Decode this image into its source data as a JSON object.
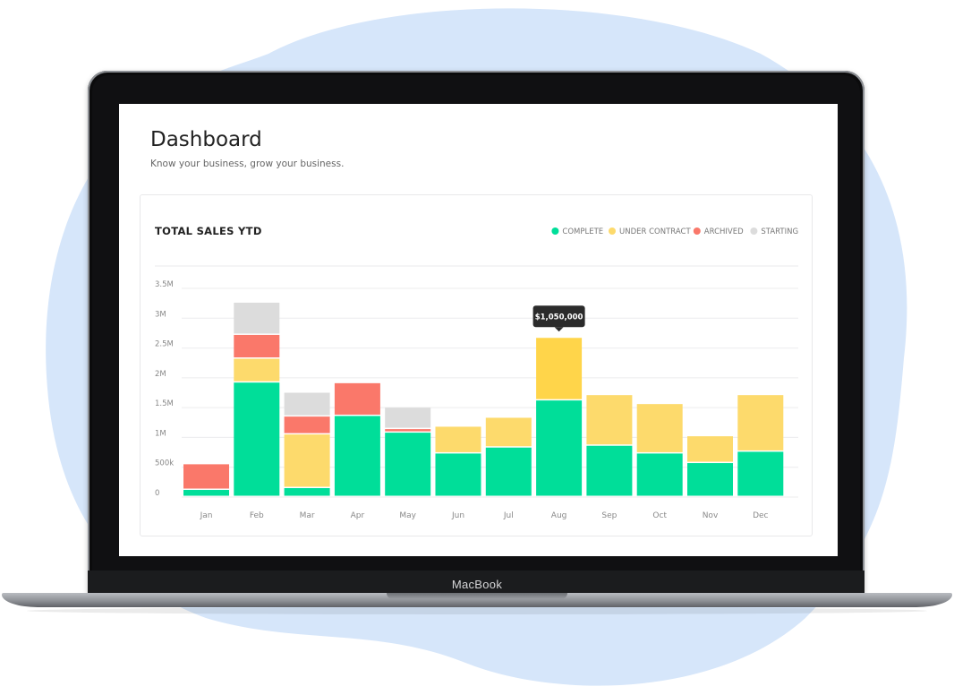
{
  "page": {
    "title": "Dashboard",
    "subtitle": "Know your business, grow your business."
  },
  "device": {
    "brand": "MacBook"
  },
  "colors": {
    "complete": "#00DE99",
    "under_contract": "#FDDA6C",
    "archived": "#FA786A",
    "starting": "#DCDCDC",
    "highlight_under_contract": "#FFD54A",
    "tooltip_bg": "#2b2b2b",
    "blob": "#D6E6FA"
  },
  "chart_data": {
    "type": "bar",
    "stacked": true,
    "title": "TOTAL SALES YTD",
    "xlabel": "",
    "ylabel": "",
    "ylim": [
      0,
      3500000
    ],
    "yticks": [
      0,
      500000,
      1000000,
      1500000,
      2000000,
      2500000,
      3000000,
      3500000
    ],
    "ytick_labels": [
      "0",
      "500k",
      "1M",
      "1.5M",
      "2M",
      "2.5M",
      "3M",
      "3.5M"
    ],
    "grid": true,
    "legend_position": "top-right",
    "categories": [
      "Jan",
      "Feb",
      "Mar",
      "Apr",
      "May",
      "Jun",
      "Jul",
      "Aug",
      "Sep",
      "Oct",
      "Nov",
      "Dec"
    ],
    "series": [
      {
        "name": "COMPLETE",
        "color_key": "complete",
        "values": [
          120000,
          1920000,
          150000,
          1360000,
          1080000,
          730000,
          830000,
          1620000,
          860000,
          730000,
          570000,
          760000
        ]
      },
      {
        "name": "UNDER CONTRACT",
        "color_key": "under_contract",
        "values": [
          0,
          400000,
          900000,
          0,
          0,
          450000,
          500000,
          1050000,
          850000,
          830000,
          450000,
          950000
        ]
      },
      {
        "name": "ARCHIVED",
        "color_key": "archived",
        "values": [
          430000,
          400000,
          300000,
          550000,
          60000,
          0,
          0,
          0,
          0,
          0,
          0,
          0
        ]
      },
      {
        "name": "STARTING",
        "color_key": "starting",
        "values": [
          0,
          540000,
          400000,
          0,
          360000,
          0,
          0,
          0,
          0,
          0,
          0,
          0
        ]
      }
    ],
    "annotation": {
      "category": "Aug",
      "series": "UNDER CONTRACT",
      "text": "$1,050,000"
    }
  }
}
